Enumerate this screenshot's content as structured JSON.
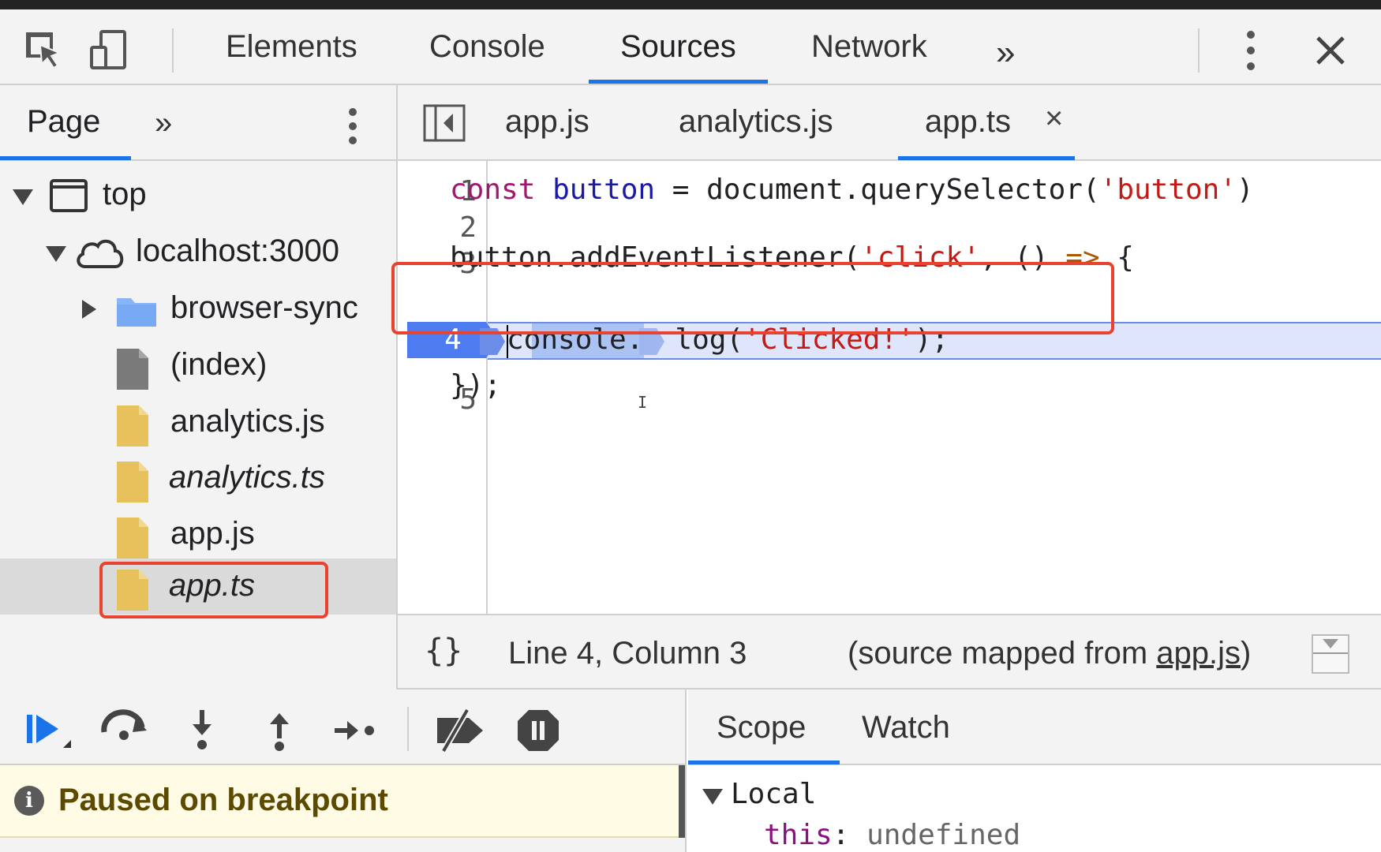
{
  "toolbar": {
    "tabs": [
      "Elements",
      "Console",
      "Sources",
      "Network"
    ],
    "active_tab": "Sources",
    "more_label": "»",
    "close_label": "✕"
  },
  "navigator": {
    "tab_label": "Page",
    "more_label": "»",
    "tree": [
      {
        "label": "top",
        "type": "frame"
      },
      {
        "label": "localhost:3000",
        "type": "domain"
      },
      {
        "label": "browser-sync",
        "type": "folder"
      },
      {
        "label": "(index)",
        "type": "document"
      },
      {
        "label": "analytics.js",
        "type": "script"
      },
      {
        "label": "analytics.ts",
        "type": "sourcemap"
      },
      {
        "label": "app.js",
        "type": "script"
      },
      {
        "label": "app.ts",
        "type": "sourcemap",
        "selected": true
      }
    ]
  },
  "editor": {
    "tabs": [
      "app.js",
      "analytics.js",
      "app.ts"
    ],
    "active_tab": "app.ts",
    "close_label": "×",
    "lines": [
      {
        "n": "1"
      },
      {
        "n": "2"
      },
      {
        "n": "3"
      },
      {
        "n": "4",
        "breakpoint": true
      },
      {
        "n": "5"
      }
    ],
    "code": {
      "l1_kw": "const",
      "l1_var": "button",
      "l1_rest": " = document.querySelector(",
      "l1_str": "'button'",
      "l1_end": ")",
      "l3_a": "button.addEventListener(",
      "l3_str": "'click'",
      "l3_b": ", () ",
      "l3_op": "=>",
      "l3_c": " {",
      "l4_a": "console.",
      "l4_b": "log(",
      "l4_str": "'Clicked!'",
      "l4_c": ");",
      "l5": "});"
    },
    "ibeam": "I"
  },
  "status": {
    "braces": "{}",
    "position": "Line 4, Column 3",
    "mapped_prefix": "(source mapped from ",
    "mapped_link": "app.js",
    "mapped_suffix": ")"
  },
  "debugger": {
    "paused_icon": "i",
    "paused_text": "Paused on breakpoint"
  },
  "scope": {
    "tabs": [
      "Scope",
      "Watch"
    ],
    "active_tab": "Scope",
    "local_label": "Local",
    "this_key": "this",
    "this_value": "undefined"
  },
  "colors": {
    "accent": "#1a73e8",
    "annotation": "#e8432e",
    "paused_bg": "#fffbe5",
    "exec_line": "#dfe6fb"
  }
}
